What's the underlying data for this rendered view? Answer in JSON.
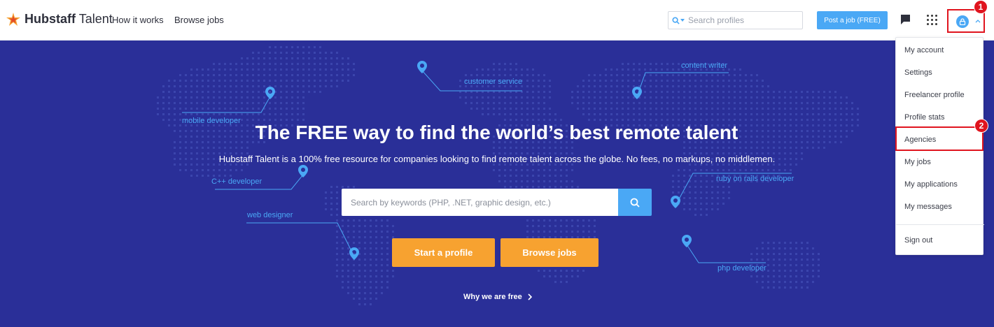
{
  "header": {
    "logo_bold": "Hubstaff",
    "logo_light": "Talent",
    "nav": [
      "How it works",
      "Browse jobs"
    ],
    "search_placeholder": "Search profiles",
    "post_job": "Post a job (FREE)"
  },
  "hero": {
    "title": "The FREE way to find the world’s best remote talent",
    "subtitle": "Hubstaff Talent is a 100% free resource for companies looking to find remote talent across the globe. No fees, no markups, no middlemen.",
    "search_placeholder": "Search by keywords (PHP, .NET, graphic design, etc.)",
    "start_profile": "Start a profile",
    "browse_jobs": "Browse jobs",
    "why_free": "Why we are free",
    "map_labels": [
      "customer service",
      "content writer",
      "mobile developer",
      "C++ developer",
      "web designer",
      "ruby on rails developer",
      "php developer"
    ]
  },
  "dropdown": {
    "items": [
      "My account",
      "Settings",
      "Freelancer profile",
      "Profile stats",
      "Agencies",
      "My jobs",
      "My applications",
      "My messages"
    ],
    "sign_out": "Sign out"
  },
  "annotations": {
    "badge1": "1",
    "badge2": "2"
  },
  "colors": {
    "hero_bg": "#2a2f98",
    "accent_blue": "#4aa8f5",
    "cta_orange": "#f7a230",
    "annotation_red": "#e0141e"
  }
}
